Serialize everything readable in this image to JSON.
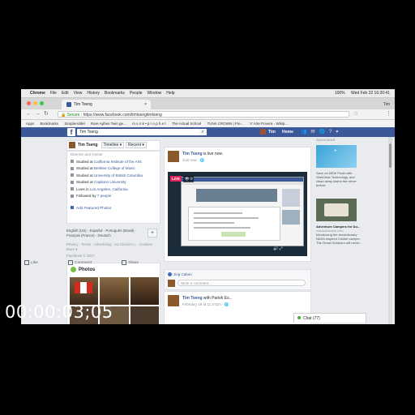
{
  "menubar": {
    "app": "Chrome",
    "items": [
      "File",
      "Edit",
      "View",
      "History",
      "Bookmarks",
      "People",
      "Window",
      "Help"
    ],
    "battery": "100%",
    "datetime": "Wed Feb 22  16:20:41"
  },
  "browser": {
    "tab_title": "Tim Tseng",
    "profile": "Tim",
    "secure_label": "Secure",
    "url": "https://www.facebook.com/timtsengtimtseng",
    "bookmarks": [
      "Apps",
      "Bookmarks",
      "SimpleAddel",
      "Rare Aphex Twin ge...",
      "m o n k • p r o p h e t",
      "The Actual School",
      "TUNA CROWN | Fre...",
      "'s' Arte Povera - Wikip..."
    ]
  },
  "fb_header": {
    "search_value": "Tim Tseng",
    "user": "Tim",
    "home": "Home"
  },
  "timeline": {
    "name": "Tim Tseng",
    "tab_timeline": "Timeline ▾",
    "tab_recent": "Recent ▾"
  },
  "intro": {
    "faded_row": "Director and Owner",
    "rows": [
      {
        "prefix": "Studied at ",
        "link": "California Institute of the Arts"
      },
      {
        "prefix": "Studied at ",
        "link": "Berklee College of Music"
      },
      {
        "prefix": "Studied at ",
        "link": "University of British Columbia"
      },
      {
        "prefix": "Studied at ",
        "link": "Capilano University"
      },
      {
        "prefix": "Lives in ",
        "link": "Los Angeles, California"
      },
      {
        "prefix": "Followed by ",
        "link": "7 people"
      }
    ],
    "featured": "Add Featured Photos"
  },
  "languages": {
    "line1": "English (US) · Español · Português (Brasil) ·",
    "line2": "Français (France) · Deutsch",
    "footer1": "Privacy · Terms · Advertising · Ad Choices ▷ · Cookies ·",
    "footer2": "More ▾",
    "footer3": "Facebook © 2017"
  },
  "photos": {
    "title": "Photos"
  },
  "post": {
    "author": "Tim Tseng",
    "action": " is live now.",
    "meta": "Just now · 🌐",
    "live_badge": "LIVE",
    "viewers": "👁 0",
    "actions": [
      "Like",
      "Comment",
      "Share"
    ],
    "liker": "Jing Cabon",
    "comment_placeholder": "Write a comment..."
  },
  "post2": {
    "author": "Tim Tseng",
    "with": " with Parish Es...",
    "meta": "February 19 at 11:37pm · 🌐"
  },
  "sponsored": {
    "label": "Sponsored",
    "ad1_text": "Save on NEW Pools with GlasClear Technology, and clean away stains like never before.",
    "ad2_title": "Adventure Campers for Du...",
    "ad2_url": "nasacaravans.com",
    "ad2_text": "Introducing the revolutionary NASA inspired Cricket camper. The Great Outdoors will never..."
  },
  "chat": {
    "label": "Chat (77)"
  },
  "timecode": "00:00:03;05"
}
